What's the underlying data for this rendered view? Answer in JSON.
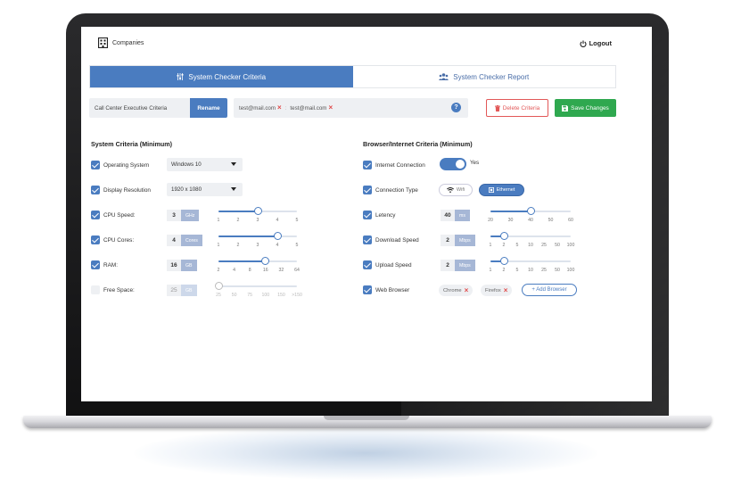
{
  "header": {
    "brand": "Companies",
    "logout": "Logout"
  },
  "tabs": [
    {
      "label": "System Checker Criteria",
      "active": true,
      "icon": "sliders-icon"
    },
    {
      "label": "System Checker Report",
      "active": false,
      "icon": "users-icon"
    }
  ],
  "toolbar": {
    "profile_name": "Call Center Executive Criteria",
    "rename_label": "Rename",
    "emails": [
      "test@mail.com",
      "test@mail.com"
    ],
    "help": "?",
    "delete_label": "Delete Criteria",
    "save_label": "Save Changes"
  },
  "system": {
    "title": "System Criteria (Minimum)",
    "os": {
      "label": "Operating System",
      "value": "Windows 10",
      "checked": true
    },
    "resolution": {
      "label": "Display Resolution",
      "value": "1920 x 1080",
      "checked": true
    },
    "cpu_speed": {
      "label": "CPU Speed:",
      "value": "3",
      "unit": "GHz",
      "checked": true,
      "ticks": [
        "1",
        "2",
        "3",
        "4",
        "5"
      ],
      "selected_index": 2
    },
    "cpu_cores": {
      "label": "CPU Cores:",
      "value": "4",
      "unit": "Cores",
      "checked": true,
      "ticks": [
        "1",
        "2",
        "3",
        "4",
        "5"
      ],
      "selected_index": 3
    },
    "ram": {
      "label": "RAM:",
      "value": "16",
      "unit": "GB",
      "checked": true,
      "ticks": [
        "2",
        "4",
        "8",
        "16",
        "32",
        "64"
      ],
      "selected_index": 3
    },
    "free_space": {
      "label": "Free Space:",
      "value": "25",
      "unit": "GB",
      "checked": false,
      "ticks": [
        "25",
        "50",
        "75",
        "100",
        "150",
        ">150"
      ],
      "selected_index": 0
    }
  },
  "browser": {
    "title": "Browser/Internet Criteria (Minimum)",
    "internet": {
      "label": "Internet Connection",
      "value": "Yes",
      "checked": true
    },
    "connection": {
      "label": "Connection Type",
      "options": [
        "Wifi",
        "Ethernet"
      ],
      "selected": "Ethernet",
      "checked": true
    },
    "latency": {
      "label": "Letency",
      "value": "40",
      "unit": "ms",
      "checked": true,
      "ticks": [
        "20",
        "30",
        "40",
        "50",
        "60"
      ],
      "selected_index": 2
    },
    "download": {
      "label": "Download Speed",
      "value": "2",
      "unit": "Mbps",
      "checked": true,
      "ticks": [
        "1",
        "2",
        "5",
        "10",
        "25",
        "50",
        "100"
      ],
      "selected_index": 1
    },
    "upload": {
      "label": "Upload Speed",
      "value": "2",
      "unit": "Mbps",
      "checked": true,
      "ticks": [
        "1",
        "2",
        "5",
        "10",
        "25",
        "50",
        "100"
      ],
      "selected_index": 1
    },
    "web_browser": {
      "label": "Web Browser",
      "items": [
        "Chrome",
        "Firefox"
      ],
      "add_label": "+ Add Browser",
      "checked": true
    }
  },
  "colors": {
    "accent": "#4a7cc0",
    "danger": "#e25858",
    "success": "#2fa84f"
  }
}
